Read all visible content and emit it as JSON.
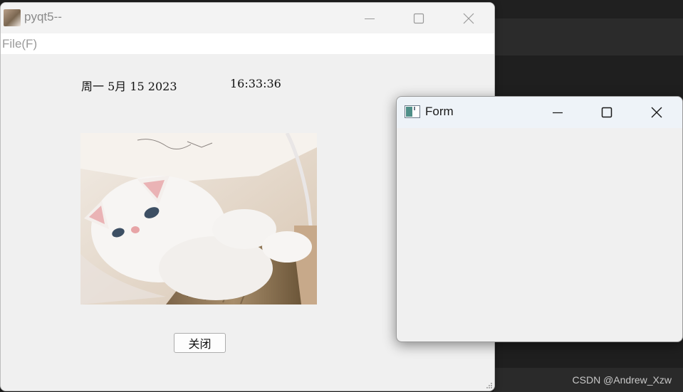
{
  "main_window": {
    "title": "pyqt5--",
    "menu": {
      "file": "File(F)"
    },
    "date_text": "周一 5月 15 2023",
    "time_text": "16:33:36",
    "close_button_label": "关闭"
  },
  "form_window": {
    "title": "Form"
  },
  "watermark": "CSDN @Andrew_Xzw",
  "icons": {
    "app": "cat-photo-icon",
    "minimize": "minimize-icon",
    "maximize": "maximize-icon",
    "close": "close-icon",
    "form_app": "qt-window-icon"
  }
}
